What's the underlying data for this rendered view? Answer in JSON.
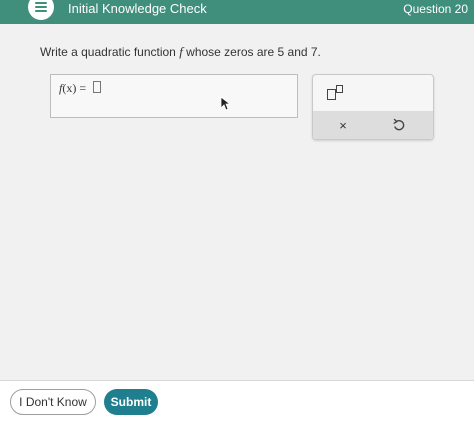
{
  "header": {
    "title": "Initial Knowledge Check",
    "right_label": "Question 20",
    "menu_icon": "hamburger-menu-icon",
    "color": "#3f8f7c"
  },
  "question": {
    "prompt_before": "Write a quadratic function ",
    "prompt_var": "f",
    "prompt_after": " whose zeros are 5 and 7."
  },
  "answer": {
    "lhs_func": "f",
    "lhs_rest": "(x) = "
  },
  "palette": {
    "superscript_icon": "superscript-icon",
    "clear_label": "×",
    "undo_icon": "undo-icon"
  },
  "footer": {
    "dont_know_label": "I Don't Know",
    "submit_label": "Submit",
    "submit_color": "#1f7f8f"
  }
}
